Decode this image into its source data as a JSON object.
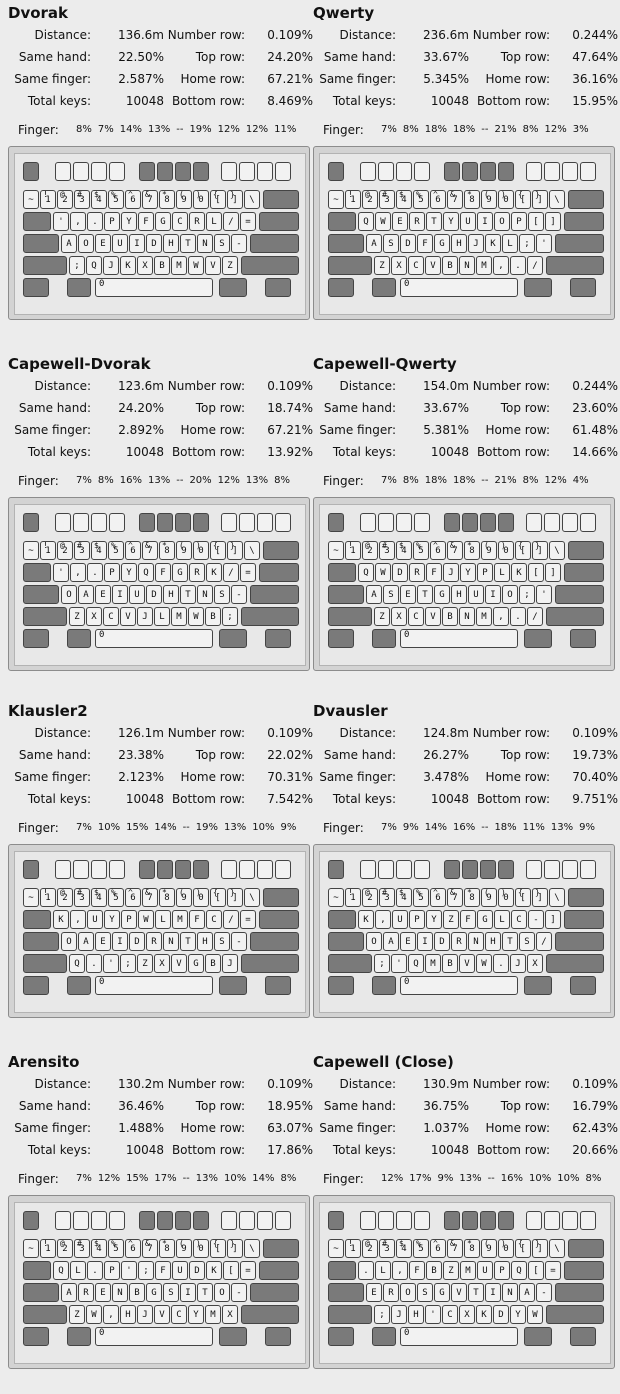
{
  "labels": {
    "distance": "Distance:",
    "same_hand": "Same hand:",
    "same_finger": "Same finger:",
    "total_keys": "Total keys:",
    "number_row": "Number row:",
    "top_row": "Top row:",
    "home_row": "Home row:",
    "bottom_row": "Bottom row:",
    "finger": "Finger:",
    "number_keys": [
      "~",
      "1",
      "2",
      "3",
      "4",
      "5",
      "6",
      "7",
      "8",
      "9",
      "0",
      "[",
      "]",
      "\\"
    ],
    "number_shift": [
      "",
      "!",
      "@",
      "#",
      "$",
      "%",
      "^",
      "&",
      "*",
      "(",
      ")",
      "{",
      "}",
      ""
    ],
    "space_marker": "0"
  },
  "layouts": [
    {
      "name": "Dvorak",
      "distance": "136.6m",
      "same_hand": "22.50%",
      "same_finger": "2.587%",
      "total_keys": "10048",
      "number_row": "0.109%",
      "top_row": "24.20%",
      "home_row": "67.21%",
      "bottom_row": "8.469%",
      "fingers": [
        "8%",
        "7%",
        "14%",
        "13%",
        "--",
        "19%",
        "12%",
        "12%",
        "11%"
      ],
      "top_keys": [
        "'",
        ",",
        ".",
        "P",
        "Y",
        "F",
        "G",
        "C",
        "R",
        "L",
        "/",
        "="
      ],
      "home_keys": [
        "A",
        "O",
        "E",
        "U",
        "I",
        "D",
        "H",
        "T",
        "N",
        "S",
        "-"
      ],
      "bottom_keys": [
        ";",
        "Q",
        "J",
        "K",
        "X",
        "B",
        "M",
        "W",
        "V",
        "Z"
      ]
    },
    {
      "name": "Qwerty",
      "distance": "236.6m",
      "same_hand": "33.67%",
      "same_finger": "5.345%",
      "total_keys": "10048",
      "number_row": "0.244%",
      "top_row": "47.64%",
      "home_row": "36.16%",
      "bottom_row": "15.95%",
      "fingers": [
        "7%",
        "8%",
        "18%",
        "18%",
        "--",
        "21%",
        "8%",
        "12%",
        "3%"
      ],
      "top_keys": [
        "Q",
        "W",
        "E",
        "R",
        "T",
        "Y",
        "U",
        "I",
        "O",
        "P",
        "[",
        "]"
      ],
      "home_keys": [
        "A",
        "S",
        "D",
        "F",
        "G",
        "H",
        "J",
        "K",
        "L",
        ";",
        "'"
      ],
      "bottom_keys": [
        "Z",
        "X",
        "C",
        "V",
        "B",
        "N",
        "M",
        ",",
        ".",
        "/"
      ]
    },
    {
      "name": "Capewell-Dvorak",
      "distance": "123.6m",
      "same_hand": "24.20%",
      "same_finger": "2.892%",
      "total_keys": "10048",
      "number_row": "0.109%",
      "top_row": "18.74%",
      "home_row": "67.21%",
      "bottom_row": "13.92%",
      "fingers": [
        "7%",
        "8%",
        "16%",
        "13%",
        "--",
        "20%",
        "12%",
        "13%",
        "8%"
      ],
      "top_keys": [
        "'",
        ",",
        ".",
        "P",
        "Y",
        "Q",
        "F",
        "G",
        "R",
        "K",
        "/",
        "="
      ],
      "home_keys": [
        "O",
        "A",
        "E",
        "I",
        "U",
        "D",
        "H",
        "T",
        "N",
        "S",
        "-"
      ],
      "bottom_keys": [
        "Z",
        "X",
        "C",
        "V",
        "J",
        "L",
        "M",
        "W",
        "B",
        ";"
      ]
    },
    {
      "name": "Capewell-Qwerty",
      "distance": "154.0m",
      "same_hand": "33.67%",
      "same_finger": "5.381%",
      "total_keys": "10048",
      "number_row": "0.244%",
      "top_row": "23.60%",
      "home_row": "61.48%",
      "bottom_row": "14.66%",
      "fingers": [
        "7%",
        "8%",
        "18%",
        "18%",
        "--",
        "21%",
        "8%",
        "12%",
        "4%"
      ],
      "top_keys": [
        "Q",
        "W",
        "D",
        "R",
        "F",
        "J",
        "Y",
        "P",
        "L",
        "K",
        "[",
        "]"
      ],
      "home_keys": [
        "A",
        "S",
        "E",
        "T",
        "G",
        "H",
        "U",
        "I",
        "O",
        ";",
        "'"
      ],
      "bottom_keys": [
        "Z",
        "X",
        "C",
        "V",
        "B",
        "N",
        "M",
        ",",
        ".",
        "/"
      ]
    },
    {
      "name": "Klausler2",
      "distance": "126.1m",
      "same_hand": "23.38%",
      "same_finger": "2.123%",
      "total_keys": "10048",
      "number_row": "0.109%",
      "top_row": "22.02%",
      "home_row": "70.31%",
      "bottom_row": "7.542%",
      "fingers": [
        "7%",
        "10%",
        "15%",
        "14%",
        "--",
        "19%",
        "13%",
        "10%",
        "9%"
      ],
      "top_keys": [
        "K",
        ",",
        "U",
        "Y",
        "P",
        "W",
        "L",
        "M",
        "F",
        "C",
        "/",
        "="
      ],
      "home_keys": [
        "O",
        "A",
        "E",
        "I",
        "D",
        "R",
        "N",
        "T",
        "H",
        "S",
        "-"
      ],
      "bottom_keys": [
        "Q",
        ".",
        "'",
        ";",
        "Z",
        "X",
        "V",
        "G",
        "B",
        "J"
      ]
    },
    {
      "name": "Dvausler",
      "distance": "124.8m",
      "same_hand": "26.27%",
      "same_finger": "3.478%",
      "total_keys": "10048",
      "number_row": "0.109%",
      "top_row": "19.73%",
      "home_row": "70.40%",
      "bottom_row": "9.751%",
      "fingers": [
        "7%",
        "9%",
        "14%",
        "16%",
        "--",
        "18%",
        "11%",
        "13%",
        "9%"
      ],
      "top_keys": [
        "K",
        ",",
        "U",
        "P",
        "Y",
        "Z",
        "F",
        "G",
        "L",
        "C",
        "-",
        "]"
      ],
      "home_keys": [
        "O",
        "A",
        "E",
        "I",
        "D",
        "R",
        "N",
        "H",
        "T",
        "S",
        "/"
      ],
      "bottom_keys": [
        ";",
        "'",
        "Q",
        "M",
        "B",
        "V",
        "W",
        ".",
        "J",
        "X"
      ]
    },
    {
      "name": "Arensito",
      "distance": "130.2m",
      "same_hand": "36.46%",
      "same_finger": "1.488%",
      "total_keys": "10048",
      "number_row": "0.109%",
      "top_row": "18.95%",
      "home_row": "63.07%",
      "bottom_row": "17.86%",
      "fingers": [
        "7%",
        "12%",
        "15%",
        "17%",
        "--",
        "13%",
        "10%",
        "14%",
        "8%"
      ],
      "top_keys": [
        "Q",
        "L",
        ".",
        "P",
        "'",
        ";",
        "F",
        "U",
        "D",
        "K",
        "[",
        "="
      ],
      "home_keys": [
        "A",
        "R",
        "E",
        "N",
        "B",
        "G",
        "S",
        "I",
        "T",
        "O",
        "-"
      ],
      "bottom_keys": [
        "Z",
        "W",
        ",",
        "H",
        "J",
        "V",
        "C",
        "Y",
        "M",
        "X"
      ]
    },
    {
      "name": "Capewell (Close)",
      "distance": "130.9m",
      "same_hand": "36.75%",
      "same_finger": "1.037%",
      "total_keys": "10048",
      "number_row": "0.109%",
      "top_row": "16.79%",
      "home_row": "62.43%",
      "bottom_row": "20.66%",
      "fingers": [
        "12%",
        "17%",
        "9%",
        "13%",
        "--",
        "16%",
        "10%",
        "10%",
        "8%"
      ],
      "top_keys": [
        ".",
        "L",
        ",",
        "F",
        "B",
        "Z",
        "M",
        "U",
        "P",
        "Q",
        "[",
        "="
      ],
      "home_keys": [
        "E",
        "R",
        "O",
        "S",
        "G",
        "V",
        "T",
        "I",
        "N",
        "A",
        "-"
      ],
      "bottom_keys": [
        ";",
        "J",
        "H",
        "'",
        "C",
        "X",
        "K",
        "D",
        "Y",
        "W"
      ]
    }
  ]
}
